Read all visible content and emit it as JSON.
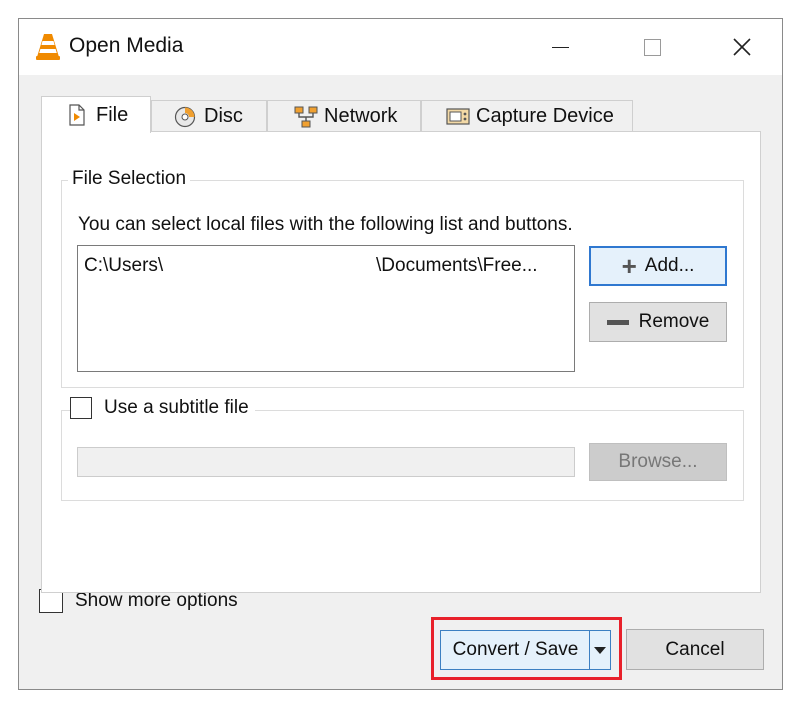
{
  "window": {
    "title": "Open Media",
    "app_icon": "vlc-cone-icon",
    "controls": [
      "minimize-icon",
      "maximize-icon",
      "close-icon"
    ]
  },
  "tabs": [
    {
      "label": "File",
      "icon": "file-play-icon",
      "active": true
    },
    {
      "label": "Disc",
      "icon": "disc-icon",
      "active": false
    },
    {
      "label": "Network",
      "icon": "network-icon",
      "active": false
    },
    {
      "label": "Capture Device",
      "icon": "capture-device-icon",
      "active": false
    }
  ],
  "file_selection": {
    "legend": "File Selection",
    "instruction": "You can select local files with the following list and buttons.",
    "file_path_start": "C:\\Users\\",
    "file_path_end": "\\Documents\\Free...",
    "add_label": "Add...",
    "remove_label": "Remove"
  },
  "subtitle": {
    "checkbox_label": "Use a subtitle file",
    "checked": false,
    "path_value": "",
    "browse_label": "Browse..."
  },
  "options": {
    "show_more_label": "Show more options",
    "checked": false
  },
  "actions": {
    "convert_save_label": "Convert / Save",
    "cancel_label": "Cancel"
  },
  "colors": {
    "highlight": "#e8202a",
    "focus_border": "#2f78d0",
    "vlc_orange": "#f08a00"
  }
}
